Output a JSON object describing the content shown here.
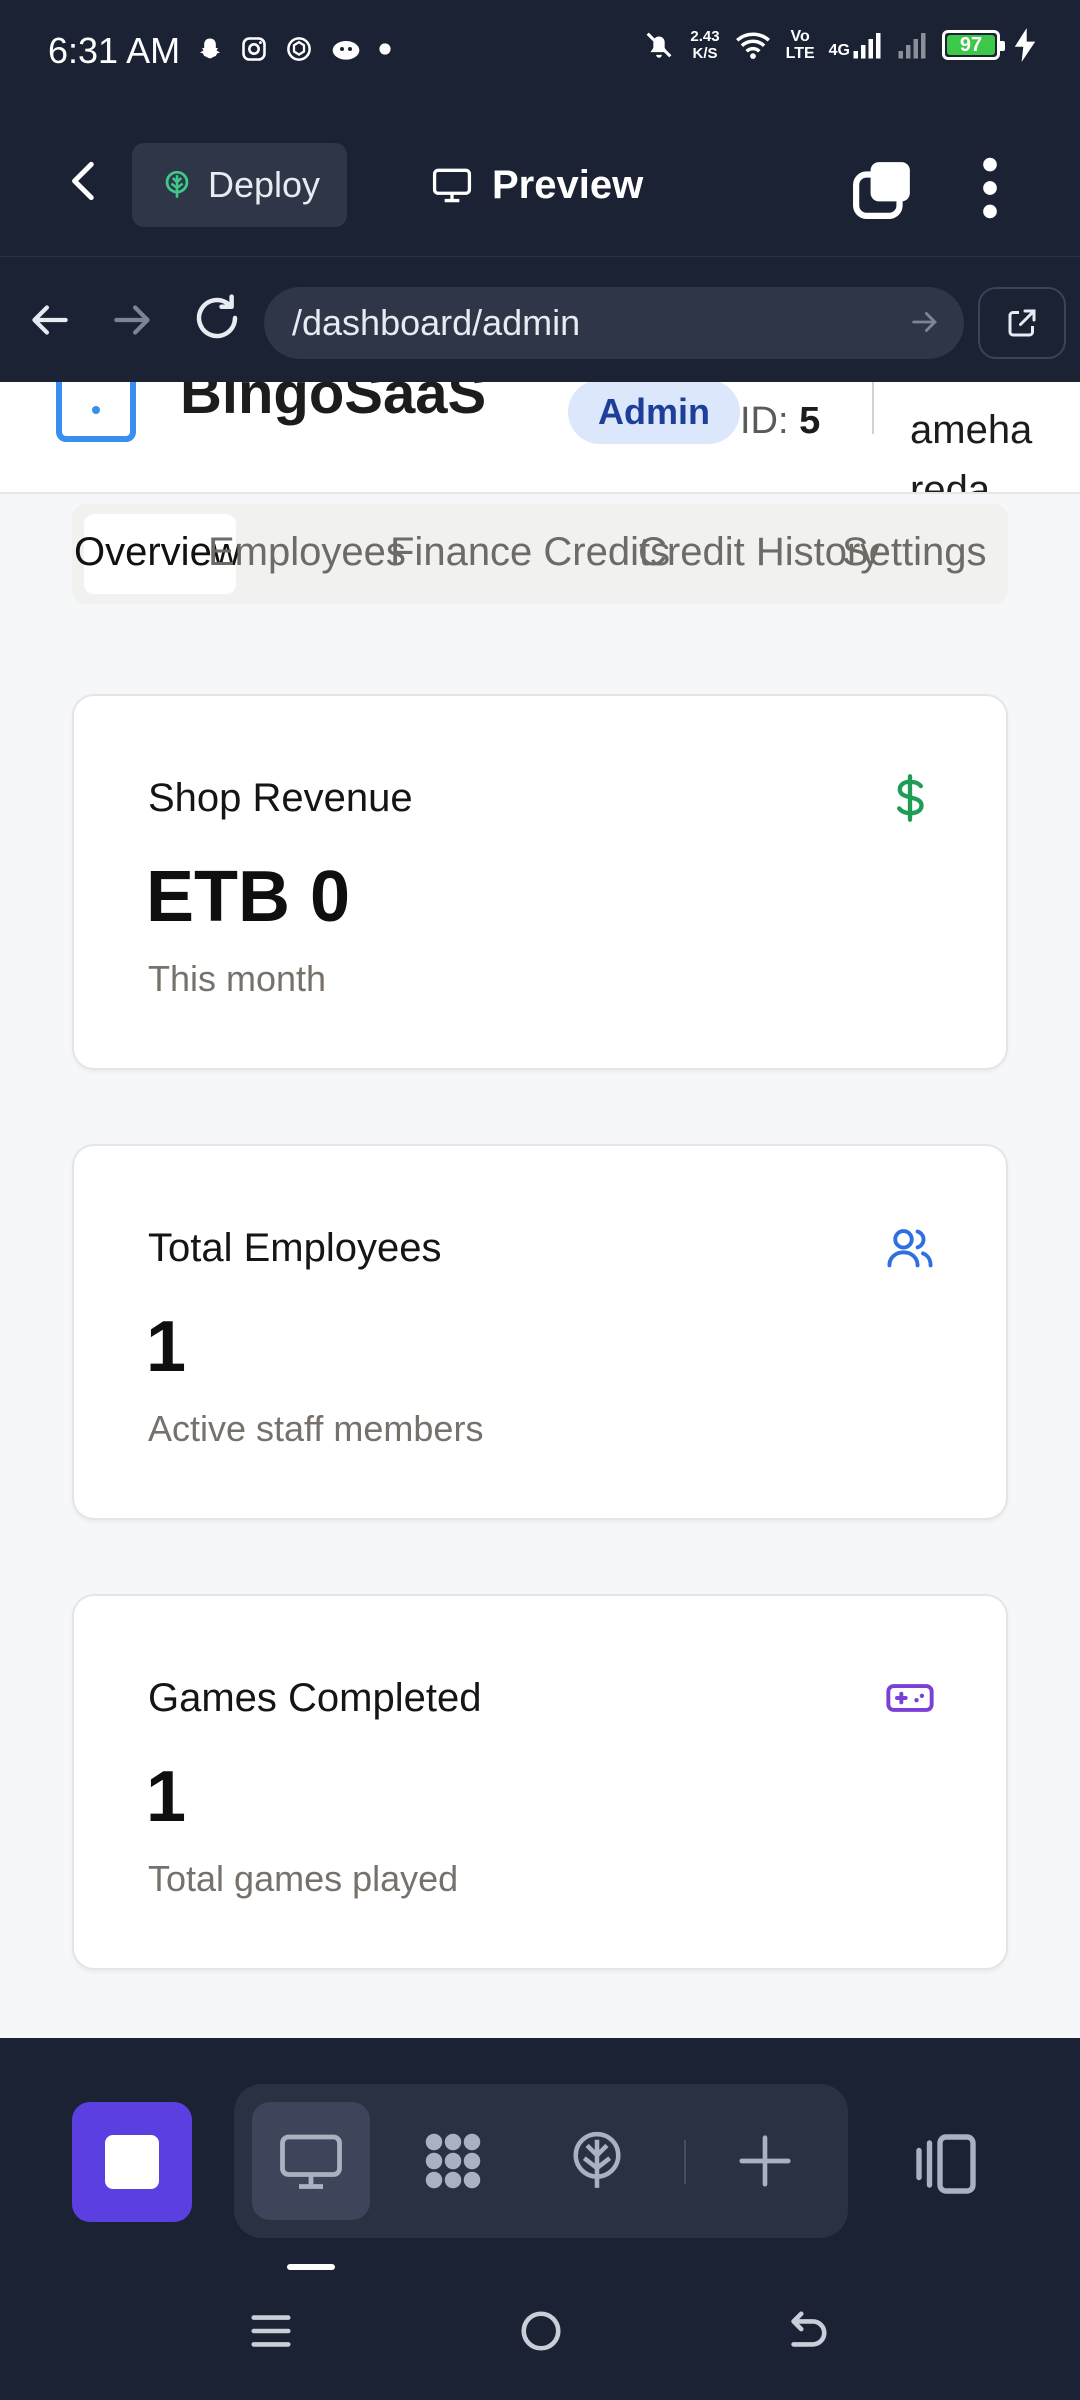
{
  "status_bar": {
    "time": "6:31 AM",
    "net_speed_value": "2.43",
    "net_speed_unit": "K/S",
    "volte_top": "Vo",
    "volte_bottom": "LTE",
    "network": "4G",
    "battery": "97"
  },
  "app_bar": {
    "deploy_label": "Deploy",
    "preview_label": "Preview"
  },
  "url_bar": {
    "url": "/dashboard/admin"
  },
  "site_header": {
    "brand": "BingoSaaS",
    "role_badge": "Admin",
    "shop_id_label": "ID:",
    "shop_id_value": "5",
    "user_line1": "ameha",
    "user_line2": "reda"
  },
  "tabs": [
    {
      "label": "Overview"
    },
    {
      "label": "Employees"
    },
    {
      "label": "Finance Credits"
    },
    {
      "label": "Credit History"
    },
    {
      "label": "Settings"
    }
  ],
  "cards": [
    {
      "title": "Shop Revenue",
      "value": "ETB 0",
      "subtitle": "This month",
      "icon": "dollar-icon"
    },
    {
      "title": "Total Employees",
      "value": "1",
      "subtitle": "Active staff members",
      "icon": "users-icon"
    },
    {
      "title": "Games Completed",
      "value": "1",
      "subtitle": "Total games played",
      "icon": "gamepad-icon"
    }
  ],
  "colors": {
    "chrome_bg": "#1b2233",
    "accent_purple": "#5b3fe0",
    "revenue_icon": "#1f9d55",
    "employees_icon": "#2f6fe0",
    "games_icon": "#7b3fd6"
  }
}
